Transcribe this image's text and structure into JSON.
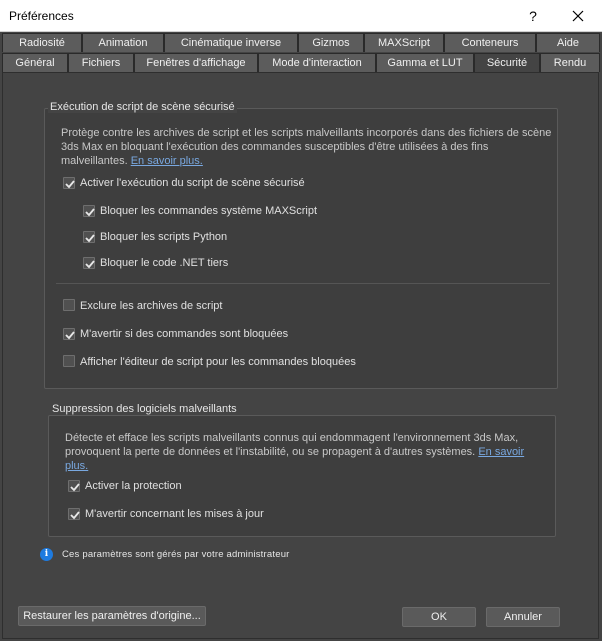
{
  "window": {
    "title": "Préférences",
    "help": "?",
    "close_icon": "close-icon"
  },
  "tabs_row1": [
    "Radiosité",
    "Animation",
    "Cinématique inverse",
    "Gizmos",
    "MAXScript",
    "Conteneurs",
    "Aide"
  ],
  "tabs_row2": [
    "Général",
    "Fichiers",
    "Fenêtres d'affichage",
    "Mode d'interaction",
    "Gamma et LUT",
    "Sécurité",
    "Rendu"
  ],
  "active_tab": "Sécurité",
  "secure_script": {
    "title": "Exécution de script de scène sécurisé",
    "desc_line1": "Protège contre les archives de script et les scripts malveillants incorporés dans des fichiers de scène",
    "desc_line2": "3ds Max en bloquant l'exécution des commandes susceptibles d'être utilisées à des fins",
    "desc_line3": "malveillantes.",
    "learn_more": "En savoir plus.",
    "options": [
      {
        "label": "Activer l'exécution du script de scène sécurisé",
        "checked": true
      },
      {
        "label": "Bloquer les commandes système MAXScript",
        "checked": true
      },
      {
        "label": "Bloquer les scripts Python",
        "checked": true
      },
      {
        "label": "Bloquer le code .NET tiers",
        "checked": true
      },
      {
        "label": "Exclure les archives de script",
        "checked": false
      },
      {
        "label": "M'avertir si des commandes sont bloquées",
        "checked": true
      },
      {
        "label": "Afficher l'éditeur de script pour les commandes bloquées",
        "checked": false
      }
    ]
  },
  "malware": {
    "title": "Suppression des logiciels malveillants",
    "desc_line1": "Détecte et efface les scripts malveillants connus qui endommagent l'environnement 3ds Max,",
    "desc_line2": "provoquent la perte de données et l'instabilité, ou se propagent à d'autres systèmes.",
    "learn_more_a": "En savoir",
    "learn_more_b": "plus.",
    "options": [
      {
        "label": "Activer la protection",
        "checked": true
      },
      {
        "label": "M'avertir concernant les mises à jour",
        "checked": true
      }
    ]
  },
  "info": {
    "icon": "info-icon",
    "text": "Ces paramètres sont gérés par votre administrateur"
  },
  "buttons": {
    "restore": "Restaurer les paramètres d'origine...",
    "ok": "OK",
    "cancel": "Annuler"
  },
  "colors": {
    "background": "#444444",
    "link": "#79a8e0",
    "info_blue": "#1e7be0"
  }
}
